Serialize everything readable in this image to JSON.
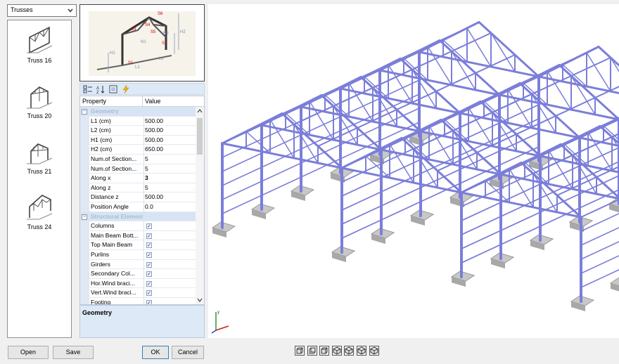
{
  "dropdown": {
    "selected": "Trusses"
  },
  "library": {
    "items": [
      {
        "label": "Truss 16"
      },
      {
        "label": "Truss 20"
      },
      {
        "label": "Truss 21"
      },
      {
        "label": "Truss 24"
      }
    ]
  },
  "preview": {
    "labels": [
      "S1",
      "S2",
      "S3",
      "S4",
      "S5",
      "S6",
      "N1",
      "N2",
      "L1",
      "L2",
      "H1",
      "H2"
    ]
  },
  "toolbar": {
    "icons": [
      "categorized-icon",
      "sort-alpha-icon",
      "property-pages-icon",
      "events-icon"
    ]
  },
  "grid": {
    "header_property": "Property",
    "header_value": "Value",
    "rows": [
      {
        "type": "cat",
        "name": "Geometry",
        "val": ""
      },
      {
        "type": "prop",
        "name": "L1 (cm)",
        "val": "500.00"
      },
      {
        "type": "prop",
        "name": "L2 (cm)",
        "val": "500.00"
      },
      {
        "type": "prop",
        "name": "H1 (cm)",
        "val": "500.00"
      },
      {
        "type": "prop",
        "name": "H2 (cm)",
        "val": "650.00"
      },
      {
        "type": "prop",
        "name": "Num.of Section...",
        "val": "5"
      },
      {
        "type": "prop",
        "name": "Num.of Section...",
        "val": "5"
      },
      {
        "type": "prop",
        "name": "Along x",
        "val": "3"
      },
      {
        "type": "prop",
        "name": "Along z",
        "val": "5"
      },
      {
        "type": "prop",
        "name": "Distance z",
        "val": "500.00"
      },
      {
        "type": "prop",
        "name": "Position Angle",
        "val": "0.0"
      },
      {
        "type": "cat",
        "name": "Structural Elements",
        "val": ""
      },
      {
        "type": "chk",
        "name": "Columns",
        "val": "✓"
      },
      {
        "type": "chk",
        "name": "Main Beam Bott...",
        "val": "✓"
      },
      {
        "type": "chk",
        "name": "Top Main Beam",
        "val": "✓"
      },
      {
        "type": "chk",
        "name": "Purlins",
        "val": "✓"
      },
      {
        "type": "chk",
        "name": "Girders",
        "val": "✓"
      },
      {
        "type": "chk",
        "name": "Secondary Col...",
        "val": "✓"
      },
      {
        "type": "chk",
        "name": "Hor.Wind braci...",
        "val": "✓"
      },
      {
        "type": "chk",
        "name": "Vert.Wind braci...",
        "val": "✓"
      },
      {
        "type": "chk",
        "name": "Footing",
        "val": "✓"
      }
    ]
  },
  "description": {
    "title": "Geometry"
  },
  "buttons": {
    "open": "Open",
    "save": "Save",
    "ok": "OK",
    "cancel": "Cancel"
  },
  "view_buttons": [
    "view-front-icon",
    "view-back-icon",
    "view-side-icon",
    "view-iso1-icon",
    "view-iso2-icon",
    "view-iso3-icon",
    "view-iso4-icon"
  ],
  "colors": {
    "truss": "#7b7ed9",
    "truss_dark": "#3d40a8",
    "footing": "#c8c8c8"
  }
}
